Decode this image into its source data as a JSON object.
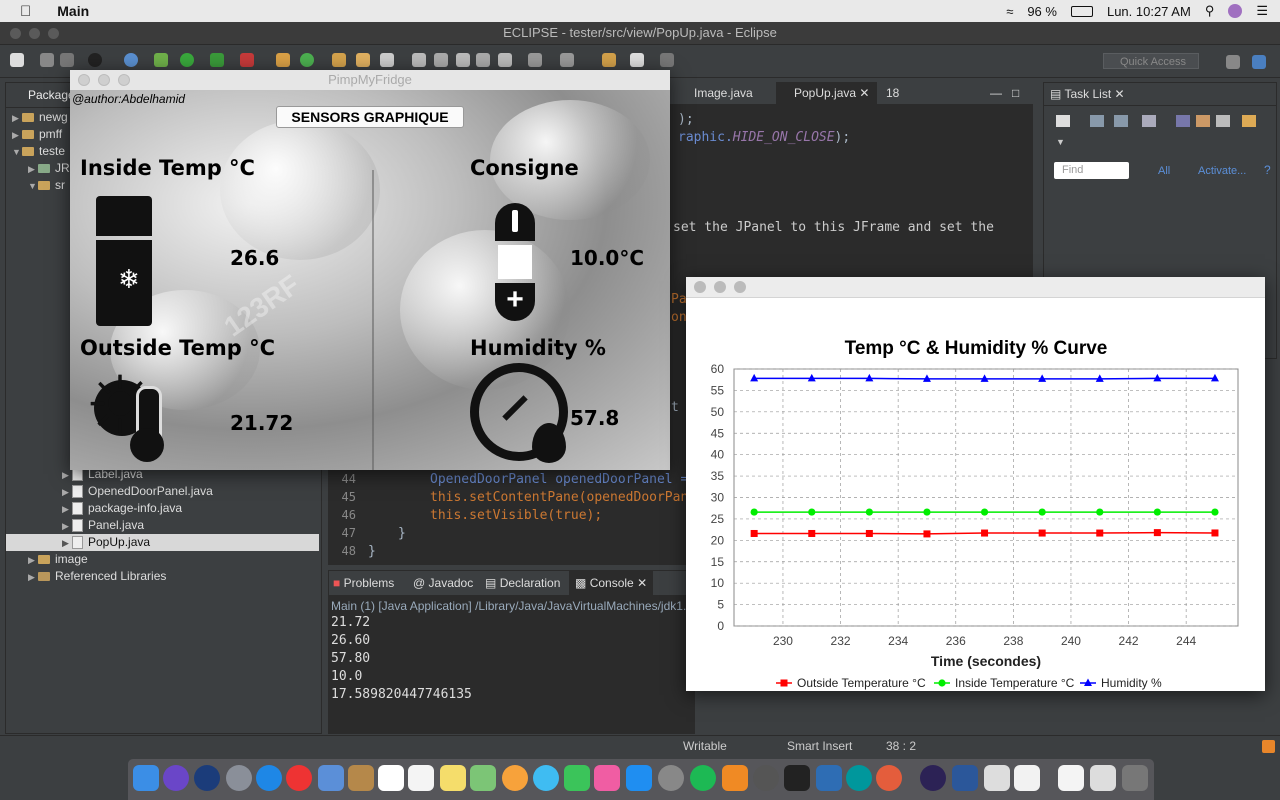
{
  "menubar": {
    "app_name": "Main",
    "battery": "96 %",
    "clock": "Lun. 10:27 AM"
  },
  "eclipse": {
    "window_title": "ECLIPSE - tester/src/view/PopUp.java - Eclipse",
    "quick_access_placeholder": "Quick Access",
    "package_explorer_tab": "Package",
    "tree": [
      {
        "label": "newg",
        "indent": 0,
        "type": "project"
      },
      {
        "label": "pmff",
        "indent": 0,
        "type": "project"
      },
      {
        "label": "teste",
        "indent": 0,
        "type": "project"
      },
      {
        "label": "JR",
        "indent": 1,
        "type": "lib"
      },
      {
        "label": "sr",
        "indent": 1,
        "type": "folder"
      },
      {
        "label": "Label.java",
        "indent": 3,
        "type": "file"
      },
      {
        "label": "OpenedDoorPanel.java",
        "indent": 3,
        "type": "file"
      },
      {
        "label": "package-info.java",
        "indent": 3,
        "type": "file"
      },
      {
        "label": "Panel.java",
        "indent": 3,
        "type": "file"
      },
      {
        "label": "PopUp.java",
        "indent": 3,
        "type": "file",
        "selected": true
      },
      {
        "label": "image",
        "indent": 1,
        "type": "folder"
      },
      {
        "label": "Referenced Libraries",
        "indent": 1,
        "type": "lib"
      }
    ],
    "editor_tabs": [
      "Image.java",
      "PopUp.java",
      "18"
    ],
    "code": {
      "line_a": ");",
      "line_b_prefix": "raphic.",
      "line_b_const": "HIDE_ON_CLOSE",
      "line_b_suffix": ");",
      "comment": "set the JPanel to this JFrame and set the",
      "pan1": "Pan",
      "pan2": "onP",
      "t_char": "t",
      "l43": "OpenedDoorPanel openedDoorPanel =",
      "l44": "this.setContentPane(openedDoorPan",
      "l45": "this.setVisible(true);",
      "l46": "}",
      "l47": "}",
      "line_numbers": [
        "44",
        "45",
        "46",
        "47",
        "48"
      ]
    },
    "console_tabs": [
      "Problems",
      "Javadoc",
      "Declaration",
      "Console"
    ],
    "console_header": "Main (1) [Java Application] /Library/Java/JavaVirtualMachines/jdk1.8",
    "console_lines": [
      "21.72",
      "26.60",
      "57.80",
      "10.0",
      "17.589820447746135"
    ],
    "task_list_tab": "Task List",
    "task_find_placeholder": "Find",
    "task_all": "All",
    "task_activate": "Activate...",
    "status": {
      "writable": "Writable",
      "insert": "Smart Insert",
      "position": "38 : 2"
    }
  },
  "fridge": {
    "title": "PimpMyFridge",
    "author": "@author:Abdelhamid",
    "button": "SENSORS GRAPHIQUE",
    "inside_label": "Inside Temp °C",
    "inside_value": "26.6",
    "consigne_label": "Consigne",
    "consigne_value": "10.0°C",
    "outside_label": "Outside Temp °C",
    "outside_value": "21.72",
    "humidity_label": "Humidity %",
    "humidity_value": "57.8",
    "watermark": "123RF"
  },
  "chart_data": {
    "type": "line",
    "title": "Temp °C  & Humidity % Curve",
    "xlabel": "Time (secondes)",
    "ylabel": "",
    "x": [
      229,
      231,
      233,
      235,
      237,
      239,
      241,
      243,
      245
    ],
    "xlim": [
      228.3,
      245.8
    ],
    "ylim": [
      0,
      60
    ],
    "xticks": [
      230,
      232,
      234,
      236,
      238,
      240,
      242,
      244
    ],
    "yticks": [
      0,
      5,
      10,
      15,
      20,
      25,
      30,
      35,
      40,
      45,
      50,
      55,
      60
    ],
    "grid": true,
    "legend_position": "bottom",
    "series": [
      {
        "name": "Outside Temperature °C",
        "color": "#ff0000",
        "marker": "square",
        "values": [
          21.6,
          21.6,
          21.6,
          21.5,
          21.7,
          21.7,
          21.7,
          21.8,
          21.72
        ]
      },
      {
        "name": "Inside Temperature °C",
        "color": "#00ee00",
        "marker": "circle",
        "values": [
          26.6,
          26.6,
          26.6,
          26.6,
          26.6,
          26.6,
          26.6,
          26.6,
          26.6
        ]
      },
      {
        "name": "Humidity %",
        "color": "#0000ff",
        "marker": "triangle",
        "values": [
          57.8,
          57.8,
          57.8,
          57.7,
          57.7,
          57.7,
          57.7,
          57.8,
          57.8
        ]
      }
    ]
  }
}
